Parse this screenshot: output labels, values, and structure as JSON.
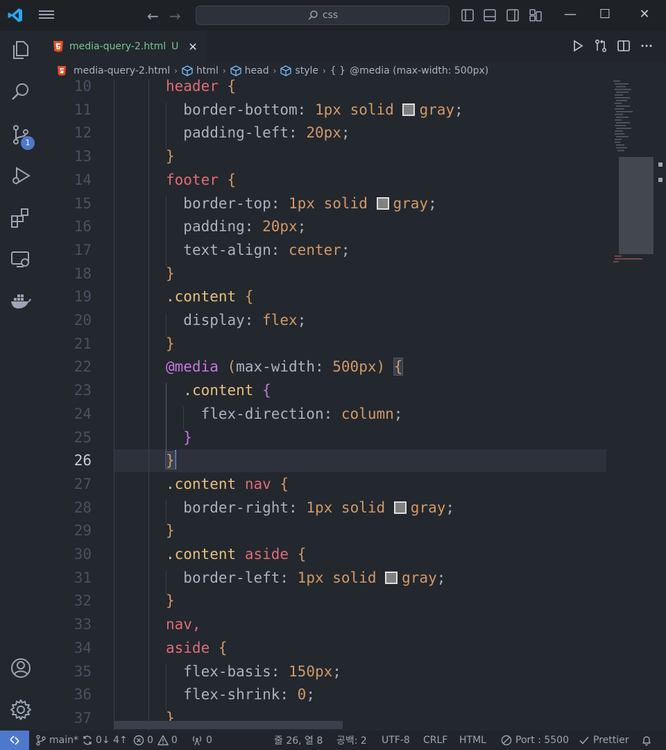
{
  "titlebar": {
    "search": "css",
    "nav_back": "←",
    "nav_forward": "→",
    "minimize": "—",
    "maximize": "☐",
    "close": "✕"
  },
  "activity": {
    "source_control_badge": "1"
  },
  "tab": {
    "label": "media-query-2.html",
    "status": "U",
    "close": "✕"
  },
  "breadcrumb": {
    "file": "media-query-2.html",
    "html": "html",
    "head": "head",
    "style": "style",
    "media_icon": "{ }",
    "media": "@media (max-width: 500px)"
  },
  "editor": {
    "active_line": 26,
    "lines": [
      {
        "n": "10"
      },
      {
        "n": "11"
      },
      {
        "n": "12"
      },
      {
        "n": "13"
      },
      {
        "n": "14"
      },
      {
        "n": "15"
      },
      {
        "n": "16"
      },
      {
        "n": "17"
      },
      {
        "n": "18"
      },
      {
        "n": "19"
      },
      {
        "n": "20"
      },
      {
        "n": "21"
      },
      {
        "n": "22"
      },
      {
        "n": "23"
      },
      {
        "n": "24"
      },
      {
        "n": "25"
      },
      {
        "n": "26"
      },
      {
        "n": "27"
      },
      {
        "n": "28"
      },
      {
        "n": "29"
      },
      {
        "n": "30"
      },
      {
        "n": "31"
      },
      {
        "n": "32"
      },
      {
        "n": "33"
      },
      {
        "n": "34"
      },
      {
        "n": "35"
      },
      {
        "n": "36"
      },
      {
        "n": "37"
      }
    ],
    "tokens": {
      "header": "header",
      "footer": "footer",
      "content": ".content",
      "nav": "nav",
      "aside": "aside",
      "nav_comma": "nav,",
      "media": "@media",
      "media_cond_open": "(",
      "media_feature": "max-width:",
      "media_value": "500px",
      "media_cond_close": ")",
      "border_bottom": "border-bottom:",
      "border_top": "border-top:",
      "border_right": "border-right:",
      "border_left": "border-left:",
      "padding_left": "padding-left:",
      "padding": "padding:",
      "text_align": "text-align:",
      "display": "display:",
      "flex_direction": "flex-direction:",
      "flex_basis": "flex-basis:",
      "flex_shrink": "flex-shrink:",
      "px1": "1px",
      "px20": "20px",
      "px150": "150px",
      "zero": "0",
      "solid": "solid",
      "gray": "gray",
      "center": "center",
      "flex": "flex",
      "column": "column",
      "semi": ";",
      "open": "{",
      "close": "}"
    }
  },
  "statusbar": {
    "branch": "main*",
    "sync": "0↓ 4↑",
    "errors": "0",
    "warnings": "0",
    "ports": "0",
    "position": "줄 26, 열 8",
    "spaces": "공백: 2",
    "encoding": "UTF-8",
    "eol": "CRLF",
    "language": "HTML",
    "port": "Port : 5500",
    "prettier": "Prettier"
  },
  "colors": {
    "accent": "#4d78cc",
    "selector": "#e5c07b",
    "number": "#d19a66",
    "at_rule": "#c678dd",
    "tag": "#e06c75",
    "untracked": "#73c991"
  }
}
